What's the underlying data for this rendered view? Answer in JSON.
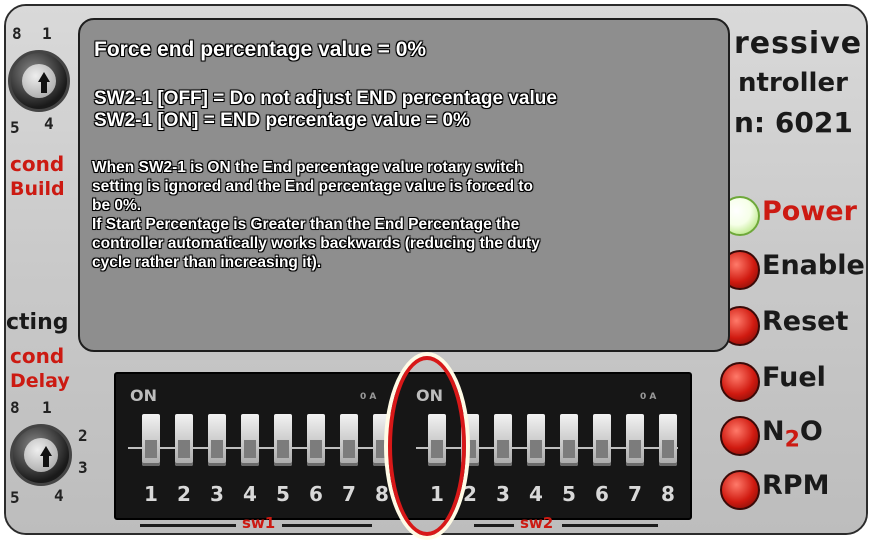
{
  "panel": {
    "brand_lines": [
      "ressive",
      "ntroller",
      "n: 6021"
    ],
    "left_labels_top": [
      "cond",
      "Build"
    ],
    "left_labels_mid": [
      "cting",
      "cond",
      "Delay"
    ],
    "rotary_top": {
      "numbers": [
        "8",
        "1",
        "5",
        "4"
      ]
    },
    "rotary_bottom": {
      "numbers": [
        "8",
        "1",
        "2",
        "3",
        "5",
        "4"
      ]
    },
    "indicators": [
      {
        "label": "Power",
        "color": "green"
      },
      {
        "label": "Enable",
        "color": "red"
      },
      {
        "label": "Reset",
        "color": "red"
      },
      {
        "label": "Fuel",
        "color": "red"
      },
      {
        "label": "N",
        "sub": "2",
        "suffix": "O",
        "color": "red"
      },
      {
        "label": "RPM",
        "color": "red"
      }
    ],
    "dip": {
      "on_label": "ON",
      "oa_label": "0 A",
      "sw1": {
        "numbers": [
          "1",
          "2",
          "3",
          "4",
          "5",
          "6",
          "7",
          "8"
        ],
        "label": "sw1"
      },
      "sw2": {
        "numbers": [
          "1",
          "2",
          "3",
          "4",
          "5",
          "6",
          "7",
          "8"
        ],
        "label": "sw2"
      }
    }
  },
  "tooltip": {
    "title": "Force end percentage value = 0%",
    "line1": "SW2-1 [OFF] = Do not adjust END percentage value",
    "line2": "SW2-1 [ON] = END percentage value = 0%",
    "body": [
      "When SW2-1 is ON the End percentage value rotary switch",
      "setting is ignored and the End percentage value is forced to",
      "be 0%.",
      "If Start Percentage is Greater than the End Percentage the",
      "controller automatically works backwards (reducing the duty",
      "cycle rather than increasing it)."
    ]
  },
  "colors": {
    "accent_red": "#d81818",
    "label_red": "#cc1a12",
    "tooltip_bg": "#8e8e8e",
    "power_led": "#9fdc5a"
  }
}
